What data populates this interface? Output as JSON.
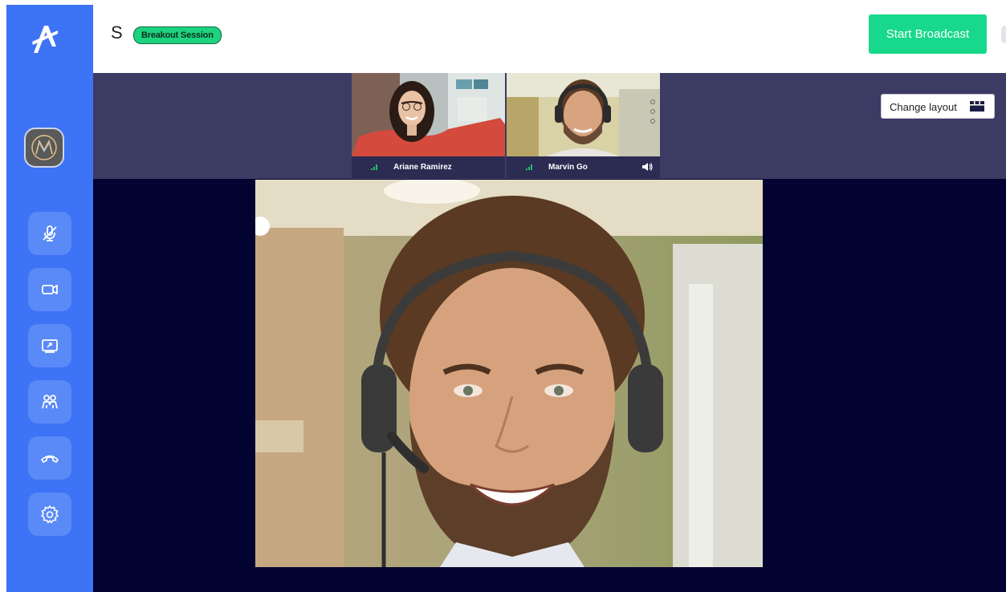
{
  "header": {
    "room_letter": "S",
    "session_badge": "Breakout Session",
    "broadcast_label": "Start Broadcast"
  },
  "stage": {
    "change_layout_label": "Change layout",
    "participants": [
      {
        "name": "Ariane Ramirez"
      },
      {
        "name": "Marvin Go"
      }
    ]
  },
  "sidebar": {
    "buttons": [
      "mic-muted-icon",
      "camera-icon",
      "screen-share-icon",
      "participants-icon",
      "hang-up-icon",
      "settings-icon"
    ]
  },
  "colors": {
    "sidebar": "#3d73f5",
    "accent_green": "#18d88b",
    "stage_bg": "#020330",
    "strip_bg": "#3c3b64"
  }
}
